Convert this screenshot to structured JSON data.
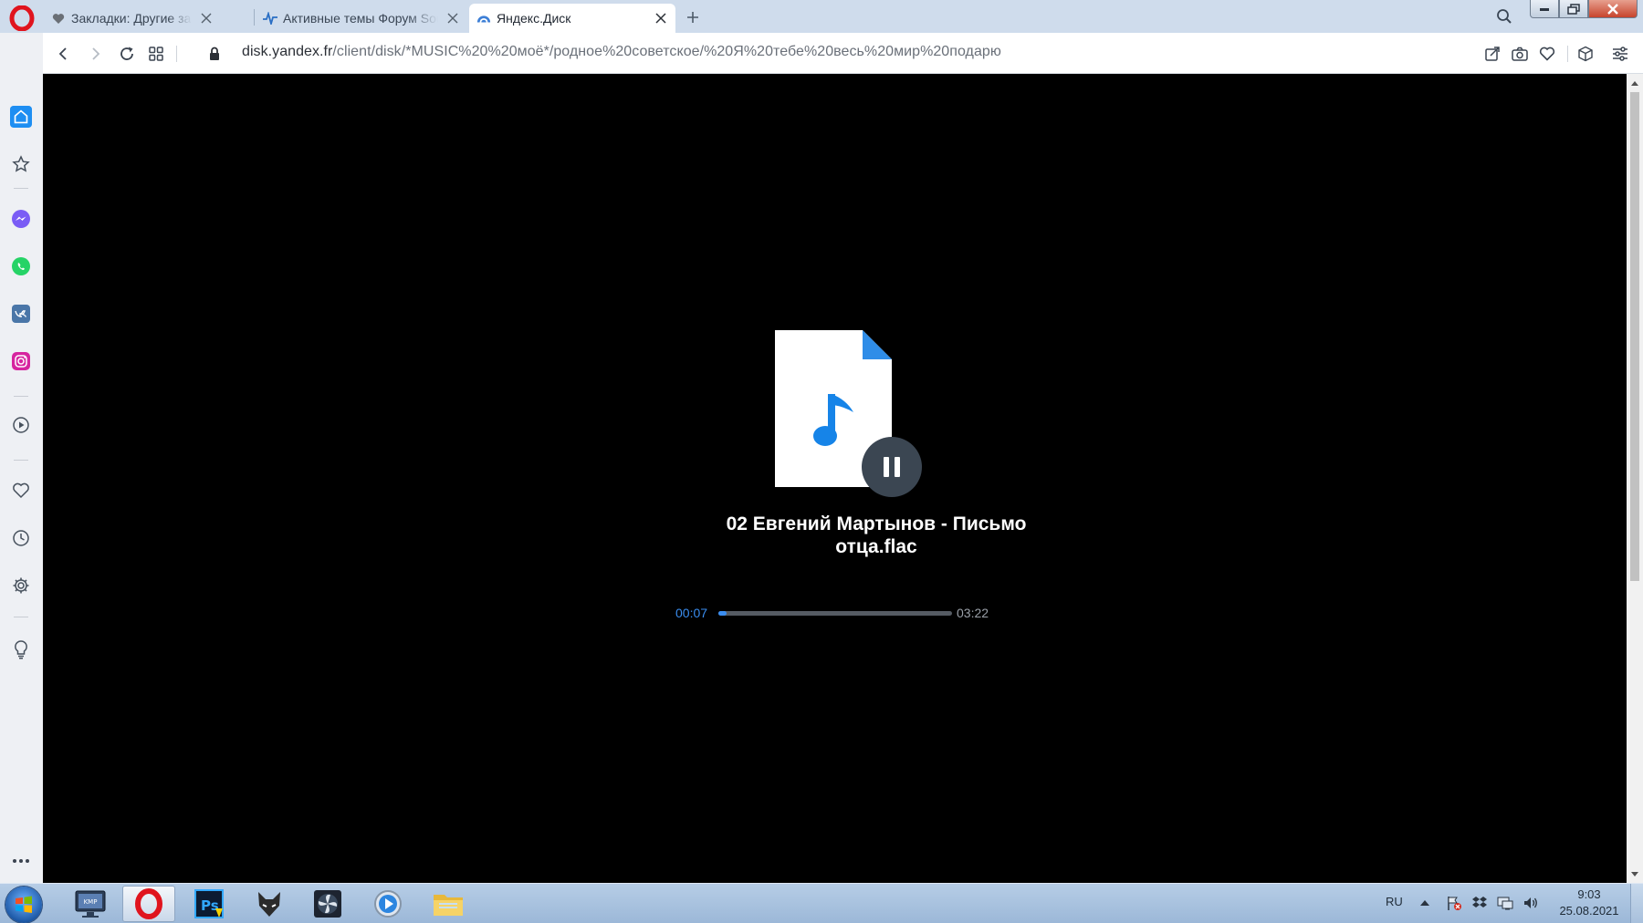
{
  "browser": {
    "tabs": [
      {
        "title": "Закладки: Другие закладки",
        "icon": "heart-icon",
        "active": false
      },
      {
        "title": "Активные темы Форум Sound",
        "icon": "forum-pulse-icon",
        "active": false
      },
      {
        "title": "Яндекс.Диск",
        "icon": "yandex-disk-icon",
        "active": true
      }
    ],
    "address": {
      "domain": "disk.yandex.fr",
      "path": "/client/disk/*MUSIC%20%20моё*/родное%20советское/%20Я%20тебе%20весь%20мир%20подарю"
    }
  },
  "player": {
    "title_line1": "02 Евгений Мартынов - Письмо",
    "title_line2": "отца.flac",
    "time_current": "00:07",
    "time_total": "03:22",
    "progress_fraction": 0.035,
    "state": "playing",
    "accent_color": "#3a8df0"
  },
  "taskbar": {
    "apps": [
      {
        "name": "kmplayer-app",
        "label": "KMP"
      },
      {
        "name": "opera-app",
        "label": ""
      },
      {
        "name": "photoshop-app",
        "label": "Ps"
      },
      {
        "name": "foobar-app",
        "label": ""
      },
      {
        "name": "fan-app",
        "label": ""
      },
      {
        "name": "media-player-app",
        "label": ""
      },
      {
        "name": "explorer-app",
        "label": ""
      }
    ],
    "language": "RU",
    "time": "9:03",
    "date": "25.08.2021"
  }
}
